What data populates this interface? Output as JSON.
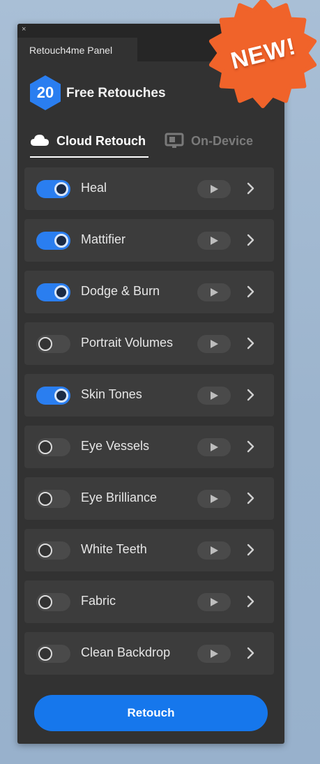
{
  "window": {
    "close_glyph": "×",
    "panel_tab": "Retouch4me Panel"
  },
  "badge": {
    "text": "NEW!",
    "color": "#f0632a"
  },
  "free": {
    "count": "20",
    "label": "Free Retouches",
    "hex_color": "#2a7ef0"
  },
  "modes": {
    "cloud": {
      "label": "Cloud Retouch",
      "icon": "cloud-icon",
      "active": true
    },
    "device": {
      "label": "On-Device",
      "icon": "monitor-icon",
      "active": false
    }
  },
  "retouches": [
    {
      "label": "Heal",
      "enabled": true
    },
    {
      "label": "Mattifier",
      "enabled": true
    },
    {
      "label": "Dodge & Burn",
      "enabled": true
    },
    {
      "label": "Portrait Volumes",
      "enabled": false
    },
    {
      "label": "Skin Tones",
      "enabled": true
    },
    {
      "label": "Eye Vessels",
      "enabled": false
    },
    {
      "label": "Eye Brilliance",
      "enabled": false
    },
    {
      "label": "White Teeth",
      "enabled": false
    },
    {
      "label": "Fabric",
      "enabled": false
    },
    {
      "label": "Clean Backdrop",
      "enabled": false
    }
  ],
  "actions": {
    "retouch_label": "Retouch",
    "accent": "#1677ec"
  }
}
